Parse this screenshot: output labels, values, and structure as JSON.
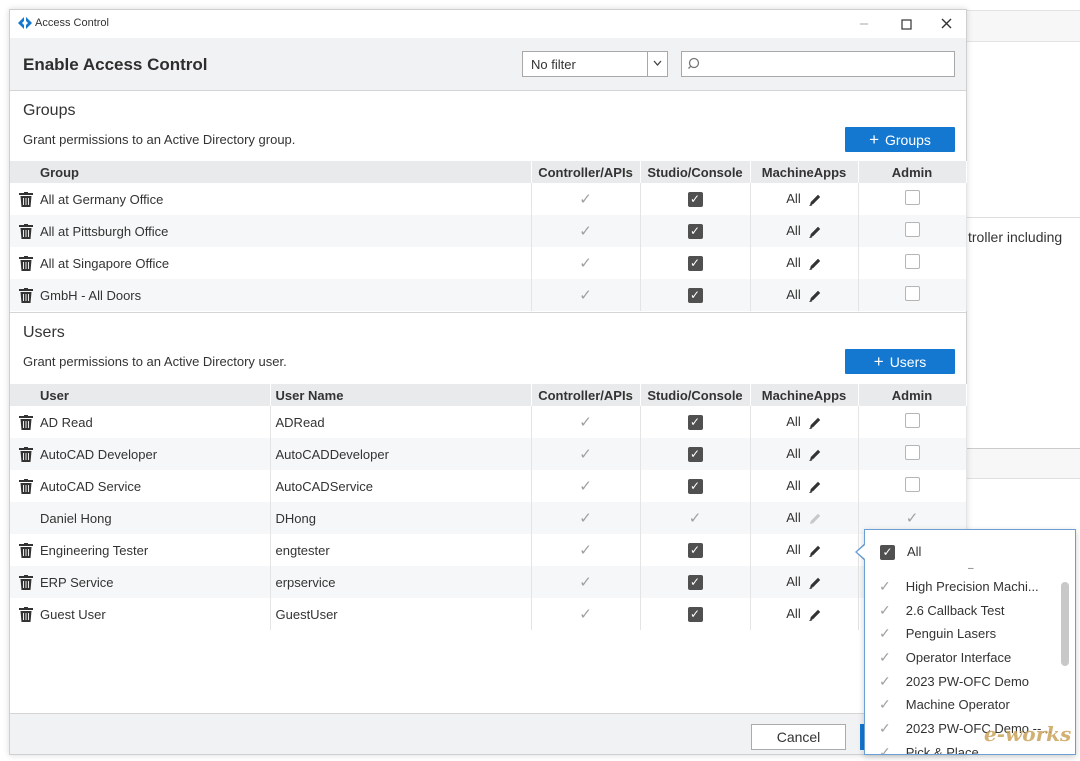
{
  "window": {
    "title": "Access Control"
  },
  "header": {
    "title": "Enable Access Control",
    "filter": "No filter",
    "search_placeholder": ""
  },
  "background": {
    "snippet": "troller including"
  },
  "groups": {
    "title": "Groups",
    "description": "Grant permissions to an Active Directory group.",
    "add_label": "Groups",
    "columns": [
      "Group",
      "Controller/APIs",
      "Studio/Console",
      "MachineApps",
      "Admin"
    ],
    "rows": [
      {
        "name": "All at Germany Office",
        "apps": "All"
      },
      {
        "name": "All at Pittsburgh Office",
        "apps": "All"
      },
      {
        "name": "All at Singapore Office",
        "apps": "All"
      },
      {
        "name": "GmbH - All Doors",
        "apps": "All"
      }
    ]
  },
  "users": {
    "title": "Users",
    "description": "Grant permissions to an Active Directory user.",
    "add_label": "Users",
    "columns": [
      "User",
      "User Name",
      "Controller/APIs",
      "Studio/Console",
      "MachineApps",
      "Admin"
    ],
    "rows": [
      {
        "name": "AD Read",
        "username": "ADRead",
        "apps": "All"
      },
      {
        "name": "AutoCAD Developer",
        "username": "AutoCADDeveloper",
        "apps": "All"
      },
      {
        "name": "AutoCAD Service",
        "username": "AutoCADService",
        "apps": "All"
      },
      {
        "name": "Daniel Hong",
        "username": "DHong",
        "apps": "All"
      },
      {
        "name": "Engineering Tester",
        "username": "engtester",
        "apps": "All"
      },
      {
        "name": "ERP Service",
        "username": "erpservice",
        "apps": "All"
      },
      {
        "name": "Guest User",
        "username": "GuestUser",
        "apps": "All"
      }
    ]
  },
  "footer": {
    "cancel_label": "Cancel"
  },
  "popup": {
    "all_label": "All",
    "items": [
      "High Precision Machi...",
      "2.6 Callback Test",
      "Penguin Lasers",
      "Operator Interface",
      "2023 PW-OFC Demo",
      "Machine Operator",
      "2023 PW-OFC Demo --...",
      "Pick & Place"
    ]
  },
  "watermark": "e-works",
  "colors": {
    "accent": "#1478d0",
    "header_bg": "#f1f2f3",
    "check_dark": "#505050"
  }
}
